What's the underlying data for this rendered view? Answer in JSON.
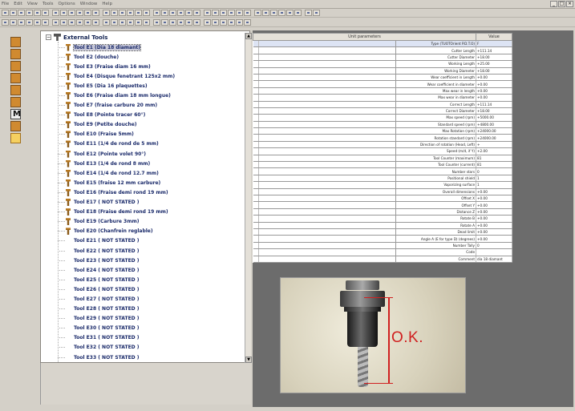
{
  "menu": [
    "File",
    "Edit",
    "View",
    "Tools",
    "Options",
    "Window",
    "Help"
  ],
  "tree": {
    "root_label": "External Tools",
    "items": [
      {
        "label": "Tool E1 (Dia 18 diamant)",
        "icon": true,
        "selected": true
      },
      {
        "label": "Tool E2 (douche)",
        "icon": true
      },
      {
        "label": "Tool E3 (Fraise diam 16 mm)",
        "icon": true
      },
      {
        "label": "Tool E4 (Disque fenetrant 125x2 mm)",
        "icon": true
      },
      {
        "label": "Tool E5 (Dia 16 plaquettes)",
        "icon": true
      },
      {
        "label": "Tool E6 (Fraise diam 18 mm longue)",
        "icon": true
      },
      {
        "label": "Tool E7 (fraise carbure 20 mm)",
        "icon": true
      },
      {
        "label": "Tool E8 (Pointe tracer 60°)",
        "icon": true
      },
      {
        "label": "Tool E9 (Petite douche)",
        "icon": true
      },
      {
        "label": "Tool E10 (Fraise 5mm)",
        "icon": true
      },
      {
        "label": "Tool E11 (1/4 de rond de 5 mm)",
        "icon": true
      },
      {
        "label": "Tool E12 (Pointe volet 90°)",
        "icon": true
      },
      {
        "label": "Tool E13 (1/4 de rond 8 mm)",
        "icon": true
      },
      {
        "label": "Tool E14 (1/4 de rond 12.7 mm)",
        "icon": true
      },
      {
        "label": "Tool E15 (fraise 12 mm carbure)",
        "icon": true
      },
      {
        "label": "Tool E16 (Fraise demi rond 19 mm)",
        "icon": true
      },
      {
        "label": "Tool E17 ( NOT STATED )",
        "icon": true
      },
      {
        "label": "Tool E18 (Fraise demi rond 19 mm)",
        "icon": true
      },
      {
        "label": "Tool E19 (Carbure 3mm)",
        "icon": true
      },
      {
        "label": "Tool E20 (Chanfrein reglable)",
        "icon": true
      },
      {
        "label": "Tool E21 ( NOT STATED )",
        "icon": false
      },
      {
        "label": "Tool E22 ( NOT STATED )",
        "icon": false
      },
      {
        "label": "Tool E23 ( NOT STATED )",
        "icon": false
      },
      {
        "label": "Tool E24 ( NOT STATED )",
        "icon": false
      },
      {
        "label": "Tool E25 ( NOT STATED )",
        "icon": false
      },
      {
        "label": "Tool E26 ( NOT STATED )",
        "icon": false
      },
      {
        "label": "Tool E27 ( NOT STATED )",
        "icon": false
      },
      {
        "label": "Tool E28 ( NOT STATED )",
        "icon": false
      },
      {
        "label": "Tool E29 ( NOT STATED )",
        "icon": false
      },
      {
        "label": "Tool E30 ( NOT STATED )",
        "icon": false
      },
      {
        "label": "Tool E31 ( NOT STATED )",
        "icon": false
      },
      {
        "label": "Tool E32 ( NOT STATED )",
        "icon": false
      },
      {
        "label": "Tool E33 ( NOT STATED )",
        "icon": false
      }
    ]
  },
  "params": {
    "header_name": "Unit parameters",
    "header_value": "Value",
    "rows": [
      {
        "name": "Type (TUOTOrient P.D.T.O)",
        "value": "F",
        "selected": true
      },
      {
        "name": "Cutter Length",
        "value": "+111.14"
      },
      {
        "name": "Cutter Diameter",
        "value": "+18.00"
      },
      {
        "name": "Working Length",
        "value": "+25.00"
      },
      {
        "name": "Working Diameter",
        "value": "+18.00"
      },
      {
        "name": "Wear coefficient in Length",
        "value": "+0.00"
      },
      {
        "name": "Wear coefficient in diameter",
        "value": "+0.00"
      },
      {
        "name": "Max wear in length",
        "value": "+0.00"
      },
      {
        "name": "Max wear in diameter",
        "value": "+0.00"
      },
      {
        "name": "Correct Length",
        "value": "+111.14"
      },
      {
        "name": "Correct Diameter",
        "value": "+18.00"
      },
      {
        "name": "Max speed (rpm)",
        "value": "+5000.00"
      },
      {
        "name": "Standard speed (rpm)",
        "value": "+4800.00"
      },
      {
        "name": "Max Rotation (rpm)",
        "value": "+24000.00"
      },
      {
        "name": "Rotation standard (rpm)",
        "value": "+24000.00"
      },
      {
        "name": "Direction of rotation (Head, Left)",
        "value": "+"
      },
      {
        "name": "Speed (m/d, if Y)",
        "value": "+2.00"
      },
      {
        "name": "Tool Counter (maximum)",
        "value": "81"
      },
      {
        "name": "Tool Counter (current)",
        "value": "81"
      },
      {
        "name": "Number stars",
        "value": "0"
      },
      {
        "name": "Positional shield",
        "value": "1"
      },
      {
        "name": "Vaporizing surface",
        "value": "1"
      },
      {
        "name": "Overall dimensions",
        "value": "+0.00"
      },
      {
        "name": "Offset X",
        "value": "+0.00"
      },
      {
        "name": "Offset Y",
        "value": "+0.00"
      },
      {
        "name": "Distance Z",
        "value": "+0.00"
      },
      {
        "name": "Rotate B",
        "value": "+0.00"
      },
      {
        "name": "Rotate A",
        "value": "+0.00"
      },
      {
        "name": "Dead limit",
        "value": "+0.00"
      },
      {
        "name": "Angle A (E for type D) (degrees)",
        "value": "+0.00"
      },
      {
        "name": "Number Tally",
        "value": "0"
      },
      {
        "name": "Code",
        "value": ""
      },
      {
        "name": "Comment",
        "value": "dia 18 diamant"
      }
    ]
  },
  "photo": {
    "annotation": "O.K."
  },
  "colors": {
    "annotation": "#d02020",
    "panel_bg": "#6c6c6c",
    "tree_text": "#1a2a6a"
  }
}
